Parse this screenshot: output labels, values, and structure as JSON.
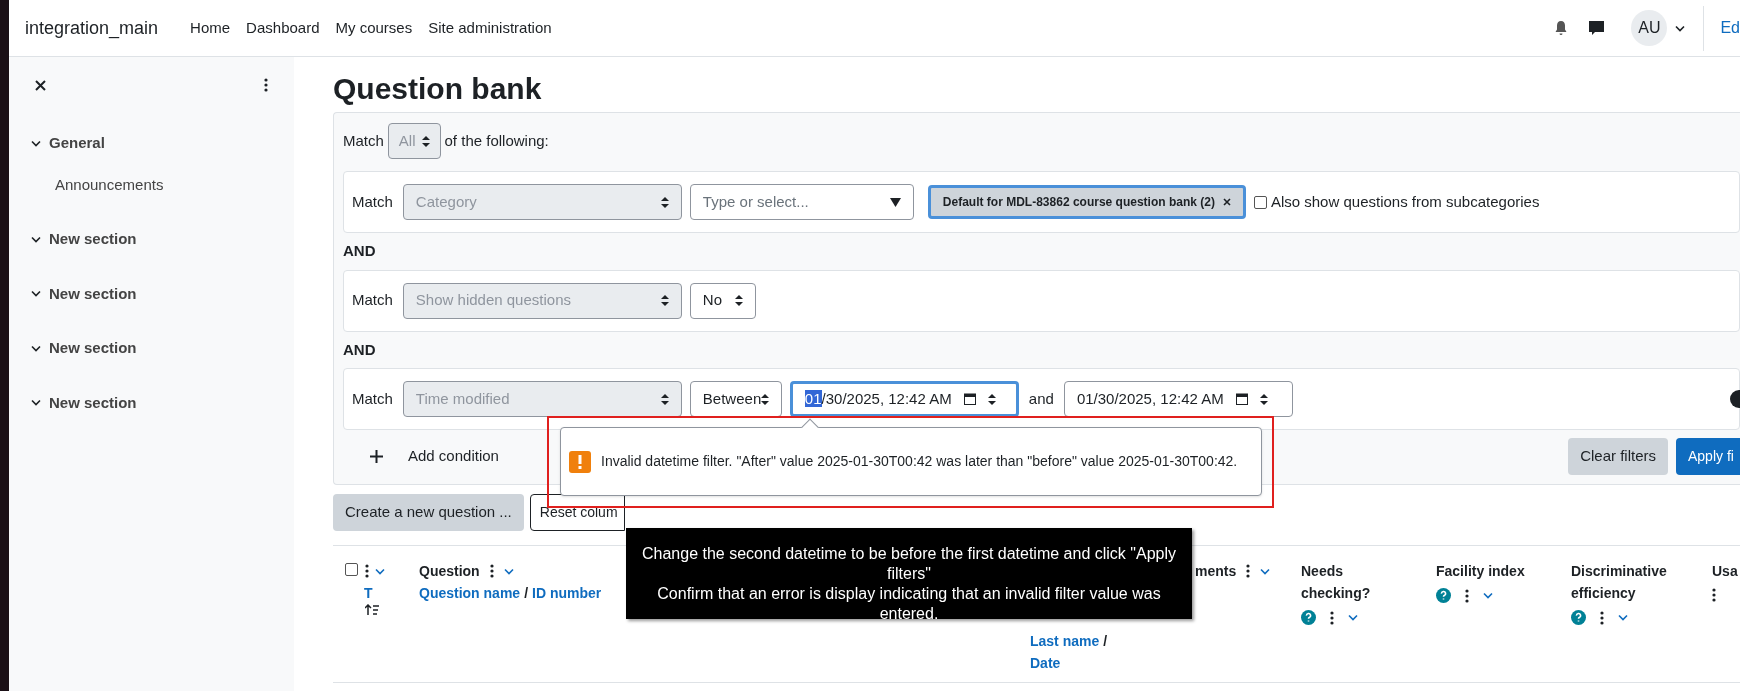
{
  "navbar": {
    "site_name": "integration_main",
    "links": [
      "Home",
      "Dashboard",
      "My courses",
      "Site administration"
    ],
    "avatar": "AU",
    "edit_link": "Ed"
  },
  "sidebar": {
    "sections": [
      {
        "title": "General",
        "expanded": true,
        "children": [
          {
            "label": "Announcements"
          }
        ]
      },
      {
        "title": "New section",
        "expanded": true
      },
      {
        "title": "New section",
        "expanded": true
      },
      {
        "title": "New section",
        "expanded": true
      },
      {
        "title": "New section",
        "expanded": true
      }
    ]
  },
  "page_title": "Question bank",
  "filters": {
    "match_label": "Match",
    "match_value": "All",
    "match_suffix": "of the following:",
    "conditions": [
      {
        "kind": "category",
        "match_label": "Match",
        "field": "Category",
        "selector_placeholder": "Type or select...",
        "chip": "Default for MDL-83862 course question bank (2)",
        "checkbox_label": "Also show questions from subcategories",
        "checked": false
      },
      {
        "kind": "select",
        "joiner": "AND",
        "match_label": "Match",
        "field": "Show hidden questions",
        "value": "No"
      },
      {
        "kind": "datetime",
        "joiner": "AND",
        "match_label": "Match",
        "field": "Time modified",
        "operator": "Between",
        "from": {
          "selected_part": "01",
          "rest": "/30/2025, 12:42 AM",
          "focused": true
        },
        "and_label": "and",
        "to": {
          "rest": "01/30/2025, 12:42 AM",
          "focused": false
        },
        "error": "Invalid datetime filter. \"After\" value 2025-01-30T00:42 was later than \"before\" value 2025-01-30T00:42."
      }
    ],
    "add_condition": "Add condition",
    "clear_button": "Clear filters",
    "apply_button": "Apply fi"
  },
  "actions": [
    "Create a new question ...",
    "Reset colum"
  ],
  "tooltip": [
    "Change the second datetime to be before the first datetime and click \"Apply filters\"",
    "Confirm that an error is display indicating that an invalid filter value was entered."
  ],
  "table": {
    "columns": [
      {
        "kind": "checkbox",
        "checked": false
      },
      {
        "kind": "type",
        "label": "T"
      },
      {
        "kind": "main",
        "title": "Question",
        "links": [
          "Question name",
          "ID number"
        ],
        "separator": "/"
      },
      {
        "kind": "creator",
        "links": [
          "Last name",
          "Date"
        ],
        "separator": "/"
      },
      {
        "kind": "plain",
        "title": "ments"
      },
      {
        "kind": "help",
        "title": "Needs checking?"
      },
      {
        "kind": "help",
        "title": "Facility index"
      },
      {
        "kind": "help",
        "title": "Discriminative efficiency"
      },
      {
        "kind": "cut",
        "title": "Usa"
      }
    ]
  }
}
